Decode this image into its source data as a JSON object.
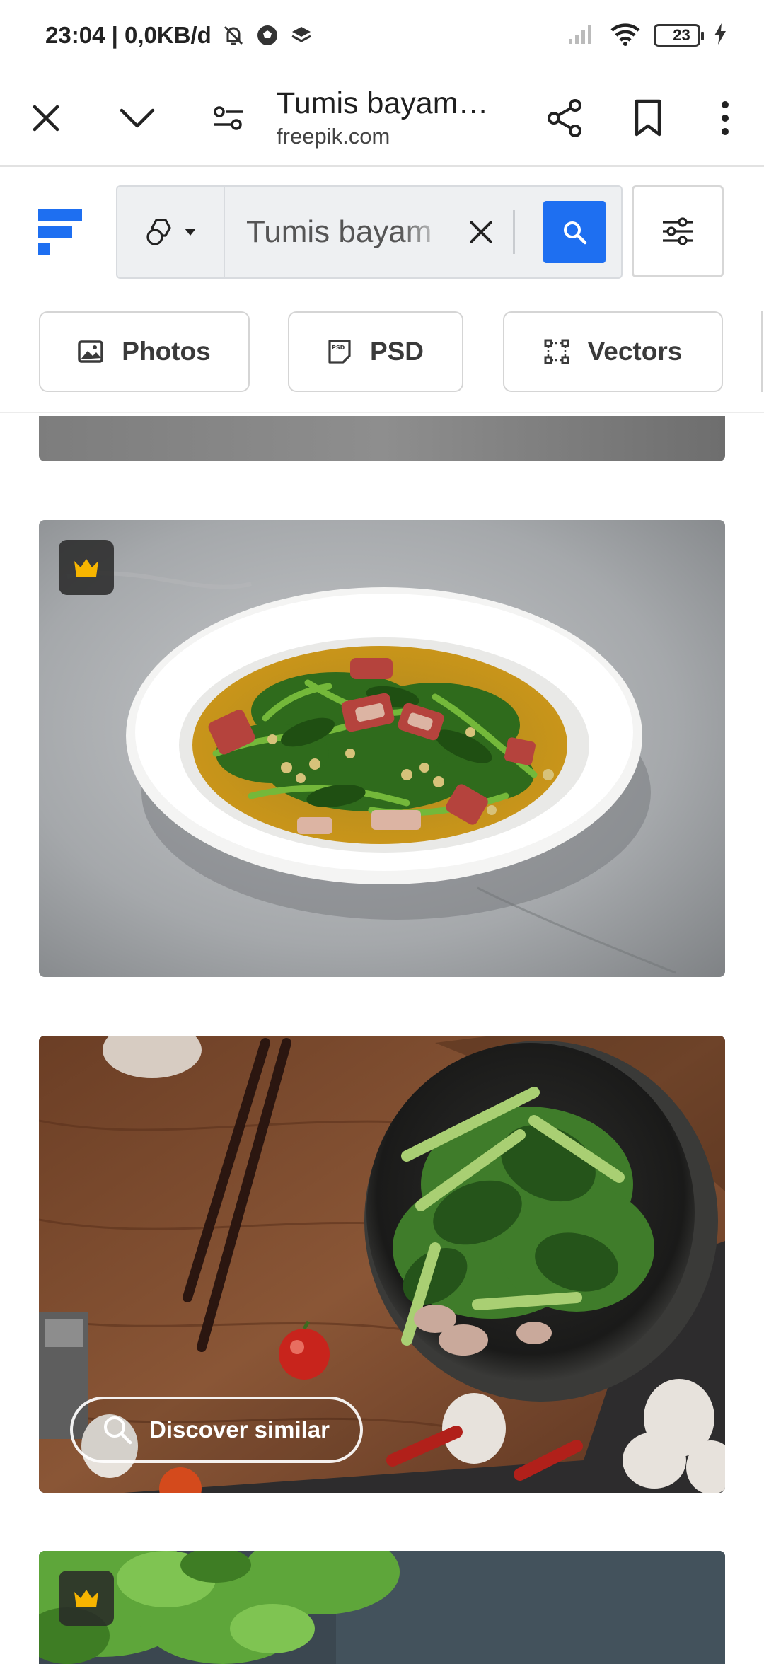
{
  "status_bar": {
    "time_and_speed": "23:04 | 0,0KB/d",
    "battery": "23"
  },
  "toolbar": {
    "title": "Tumis bayam…",
    "domain": "freepik.com"
  },
  "search": {
    "query": "Tumis bayam"
  },
  "chips": [
    {
      "label": "Photos",
      "icon": "image-icon"
    },
    {
      "label": "PSD",
      "icon": "psd-file-icon"
    },
    {
      "label": "Vectors",
      "icon": "vector-nodes-icon"
    }
  ],
  "cards": [
    {
      "name": "stir-fried-water-spinach-with-red-pork",
      "premium": true
    },
    {
      "name": "stir-fried-kale-with-pork-in-black-bowl",
      "premium": false,
      "discover_label": "Discover similar"
    },
    {
      "name": "green-vegetables-on-dark-surface",
      "premium": true
    }
  ],
  "colors": {
    "brand_blue": "#1e6ff1",
    "premium_crown": "#f7b500",
    "battery_green": "#35c759"
  }
}
